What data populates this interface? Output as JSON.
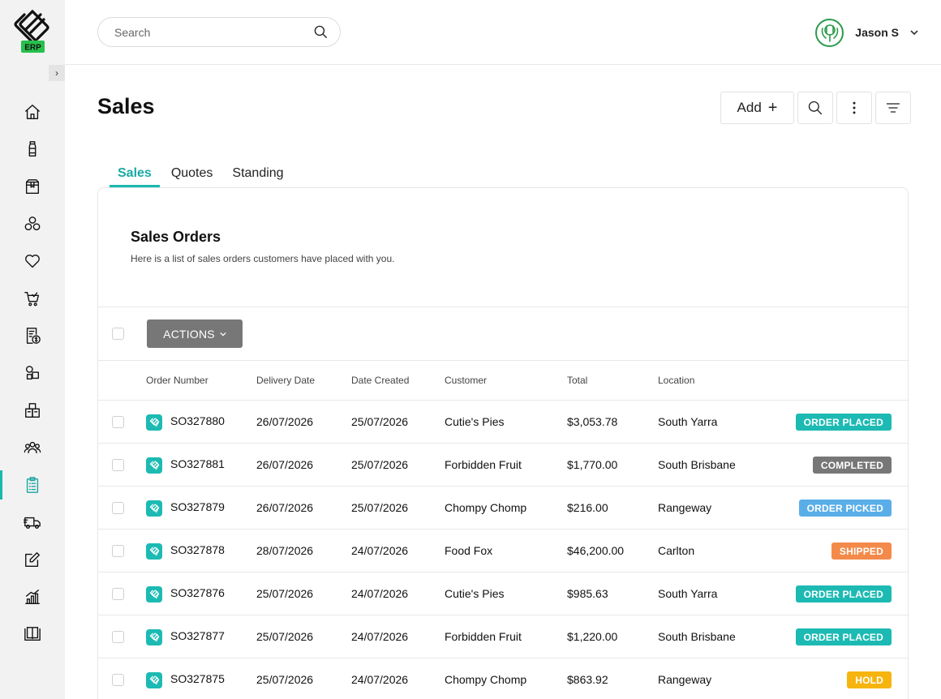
{
  "app": {
    "logo_text": "ERP"
  },
  "header": {
    "search_placeholder": "Search",
    "user_name": "Jason S"
  },
  "sidebar": {
    "active_index": 10,
    "items": [
      {
        "icon": "home-icon"
      },
      {
        "icon": "bottle-icon"
      },
      {
        "icon": "box-icon"
      },
      {
        "icon": "ingredients-icon"
      },
      {
        "icon": "heart-icon"
      },
      {
        "icon": "cart-check-icon"
      },
      {
        "icon": "invoice-dollar-icon"
      },
      {
        "icon": "packages-icon"
      },
      {
        "icon": "warehouse-icon"
      },
      {
        "icon": "users-icon"
      },
      {
        "icon": "clipboard-list-icon"
      },
      {
        "icon": "truck-icon"
      },
      {
        "icon": "edit-icon"
      },
      {
        "icon": "bar-chart-icon"
      },
      {
        "icon": "book-icon"
      }
    ]
  },
  "page": {
    "title": "Sales",
    "add_label": "Add",
    "tabs": [
      {
        "label": "Sales",
        "active": true
      },
      {
        "label": "Quotes",
        "active": false
      },
      {
        "label": "Standing",
        "active": false
      }
    ]
  },
  "card": {
    "title": "Sales Orders",
    "subtitle": "Here is a list of sales orders customers have placed with you.",
    "actions_label": "ACTIONS"
  },
  "table": {
    "columns": [
      "Order Number",
      "Delivery Date",
      "Date Created",
      "Customer",
      "Total",
      "Location"
    ],
    "status_colors": {
      "ORDER PLACED": "#1cbab3",
      "COMPLETED": "#777777",
      "ORDER PICKED": "#5aaee8",
      "SHIPPED": "#f38a4a",
      "HOLD": "#f6b40f"
    },
    "rows": [
      {
        "order": "SO327880",
        "delivery": "26/07/2026",
        "created": "25/07/2026",
        "customer": "Cutie's Pies",
        "total": "$3,053.78",
        "location": "South Yarra",
        "status": "ORDER PLACED"
      },
      {
        "order": "SO327881",
        "delivery": "26/07/2026",
        "created": "25/07/2026",
        "customer": "Forbidden Fruit",
        "total": "$1,770.00",
        "location": "South Brisbane",
        "status": "COMPLETED"
      },
      {
        "order": "SO327879",
        "delivery": "26/07/2026",
        "created": "25/07/2026",
        "customer": "Chompy Chomp",
        "total": "$216.00",
        "location": "Rangeway",
        "status": "ORDER PICKED"
      },
      {
        "order": "SO327878",
        "delivery": "28/07/2026",
        "created": "24/07/2026",
        "customer": "Food Fox",
        "total": "$46,200.00",
        "location": "Carlton",
        "status": "SHIPPED"
      },
      {
        "order": "SO327876",
        "delivery": "25/07/2026",
        "created": "24/07/2026",
        "customer": "Cutie's Pies",
        "total": "$985.63",
        "location": "South Yarra",
        "status": "ORDER PLACED"
      },
      {
        "order": "SO327877",
        "delivery": "25/07/2026",
        "created": "24/07/2026",
        "customer": "Forbidden Fruit",
        "total": "$1,220.00",
        "location": "South Brisbane",
        "status": "ORDER PLACED"
      },
      {
        "order": "SO327875",
        "delivery": "25/07/2026",
        "created": "24/07/2026",
        "customer": "Chompy Chomp",
        "total": "$863.92",
        "location": "Rangeway",
        "status": "HOLD"
      }
    ]
  }
}
